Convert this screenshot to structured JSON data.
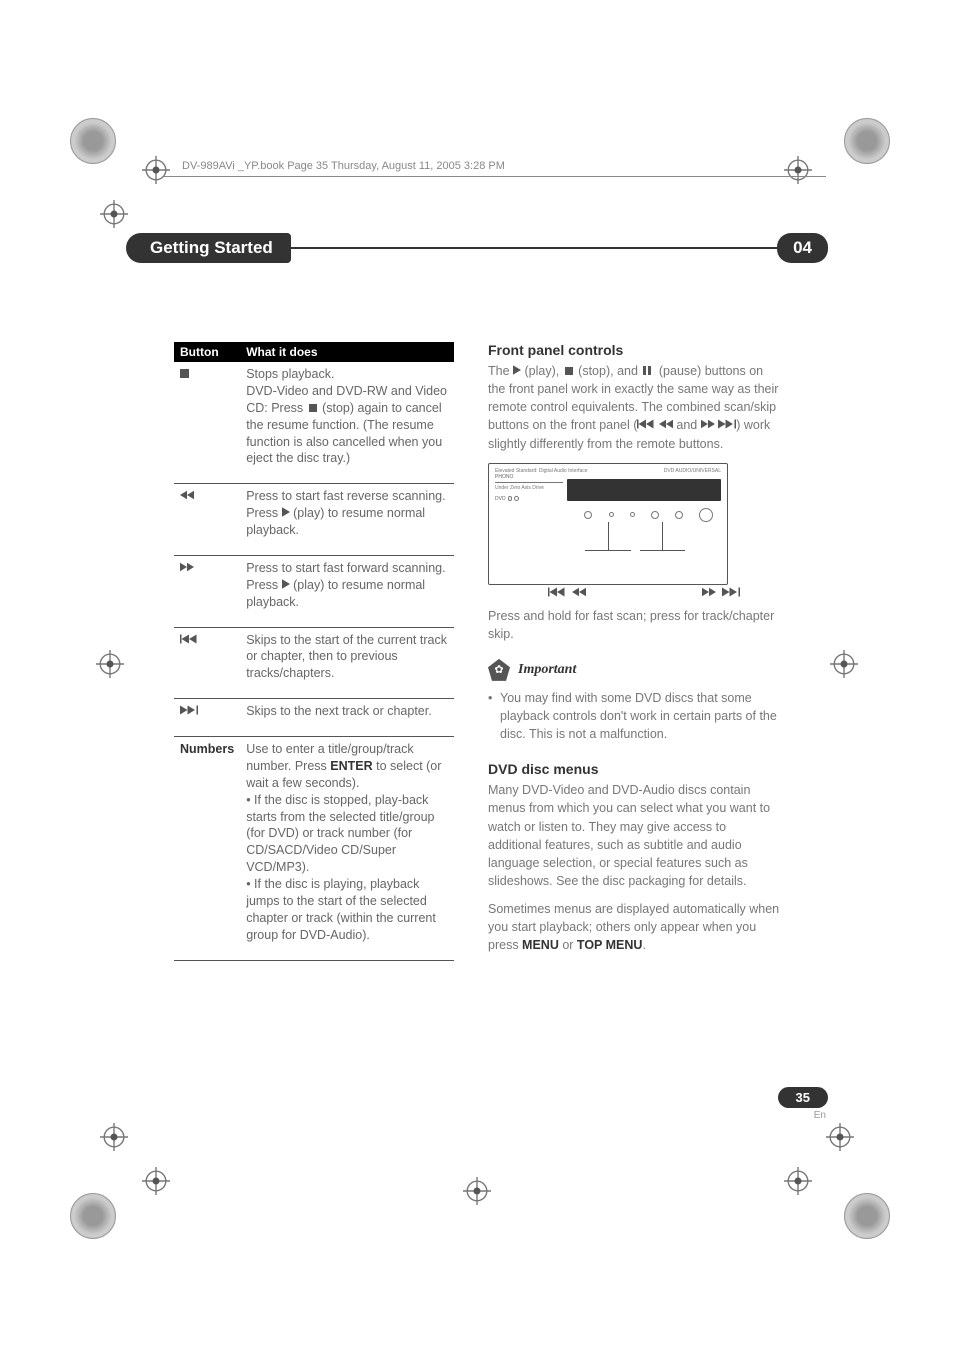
{
  "header_note": "DV-989AVi _YP.book  Page 35  Thursday, August 11, 2005  3:28 PM",
  "chapter": {
    "title": "Getting Started",
    "number": "04"
  },
  "table": {
    "headers": {
      "button": "Button",
      "desc": "What it does"
    },
    "rows": {
      "stop": "Stops playback.\nDVD-Video and DVD-RW and Video CD: Press ■ (stop) again to cancel the resume function. (The resume function is also cancelled when you eject the disc tray.)",
      "rew": "Press to start fast reverse scanning. Press ▶ (play) to resume normal playback.",
      "ffwd": "Press to start fast forward scanning. Press ▶ (play) to resume normal playback.",
      "prev": "Skips to the start of the current track or chapter, then to previous tracks/chapters.",
      "next": "Skips to the next track or chapter.",
      "numbers_label": "Numbers",
      "numbers": "Use to enter a title/group/track number. Press ENTER to select (or wait a few seconds).\n• If the disc is stopped, play-back starts from the selected title/group (for DVD) or track number (for CD/SACD/Video CD/Super VCD/MP3).\n• If the disc is playing, playback jumps to the start of the selected chapter or track (within the current group for DVD-Audio)."
    }
  },
  "front_panel": {
    "heading": "Front panel controls",
    "para1_pre": "The ",
    "para1_play": " (play), ",
    "para1_stop": " (stop), and ",
    "para1_pause": " (pause) buttons on the front panel work in exactly the same way as their remote control equivalents. The combined scan/skip buttons on the front panel (",
    "para1_mid": " and ",
    "para1_end": ") work slightly differently from the remote buttons.",
    "device_top_left": "Elevated Standard: Digital Audio Interface",
    "device_top_right": "DVD AUDIO/UNIVERSAL",
    "device_tray": "Under Zero Axis Drive",
    "device_disc": "PHONO",
    "press_hold": "Press and hold for fast scan; press for track/chapter skip."
  },
  "important": {
    "label": "Important",
    "bullet": "You may find with some DVD discs that some playback controls don't work in certain parts of the disc. This is not a malfunction."
  },
  "dvd_menus": {
    "heading": "DVD disc menus",
    "para1": "Many DVD-Video and DVD-Audio discs contain menus from which you can select what you want to watch or listen to. They may give access to additional features, such as subtitle and audio language selection, or special features such as slideshows. See the disc packaging for details.",
    "para2_pre": "Sometimes menus are displayed automatically when you start playback; others only appear when you press ",
    "menu": "MENU",
    "or": " or ",
    "top_menu": "TOP MENU",
    "dot": "."
  },
  "page": {
    "num": "35",
    "lang": "En"
  }
}
